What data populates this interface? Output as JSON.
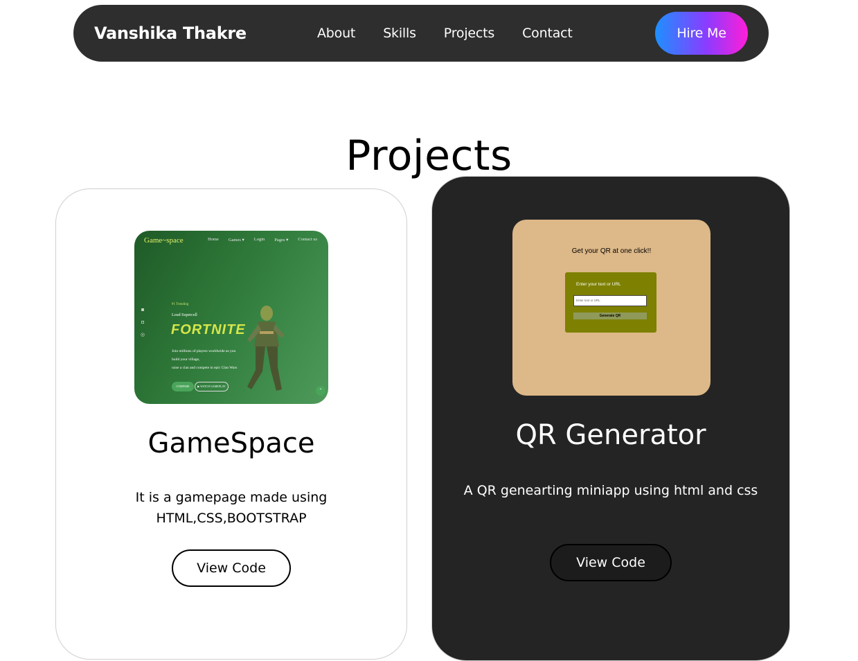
{
  "nav": {
    "brand": "Vanshika Thakre",
    "links": [
      "About",
      "Skills",
      "Projects",
      "Contact"
    ],
    "hire_label": "Hire Me"
  },
  "section": {
    "title": "Projects"
  },
  "projects": [
    {
      "title": "GameSpace",
      "description": "It is a gamepage made using HTML,CSS,BOOTSTRAP",
      "button_label": "View Code",
      "thumb": {
        "logo": "Game~space",
        "nav": [
          "Home",
          "Games ▾",
          "Login",
          "Pages ▾",
          "Contact us"
        ],
        "trending": "#1 Trending",
        "subtitle": "Loud Supercell",
        "hero": "FORTNITE",
        "text": [
          "Join millions of players worldwide as you",
          "build your village,",
          "raise a clan and compete in epic Clan Wars"
        ],
        "btn1": "COMPARE",
        "btn2": "▶ WATCH GAMEPLAY"
      }
    },
    {
      "title": "QR Generator",
      "description": "A QR genearting miniapp using html and css",
      "button_label": "View Code",
      "thumb": {
        "heading": "Get your QR at one click!!",
        "label": "Enter your text or URL",
        "placeholder": "Enter text or URL",
        "button": "Generate QR"
      }
    }
  ],
  "colors": {
    "navbar_bg": "#2e2e2e",
    "hire_gradient": [
      "#1e90ff",
      "#8a3cff",
      "#ff1ed8"
    ],
    "dark_card_bg": "#242424",
    "qr_thumb_bg": "#ddb888",
    "qr_panel_bg": "#7d8000"
  }
}
